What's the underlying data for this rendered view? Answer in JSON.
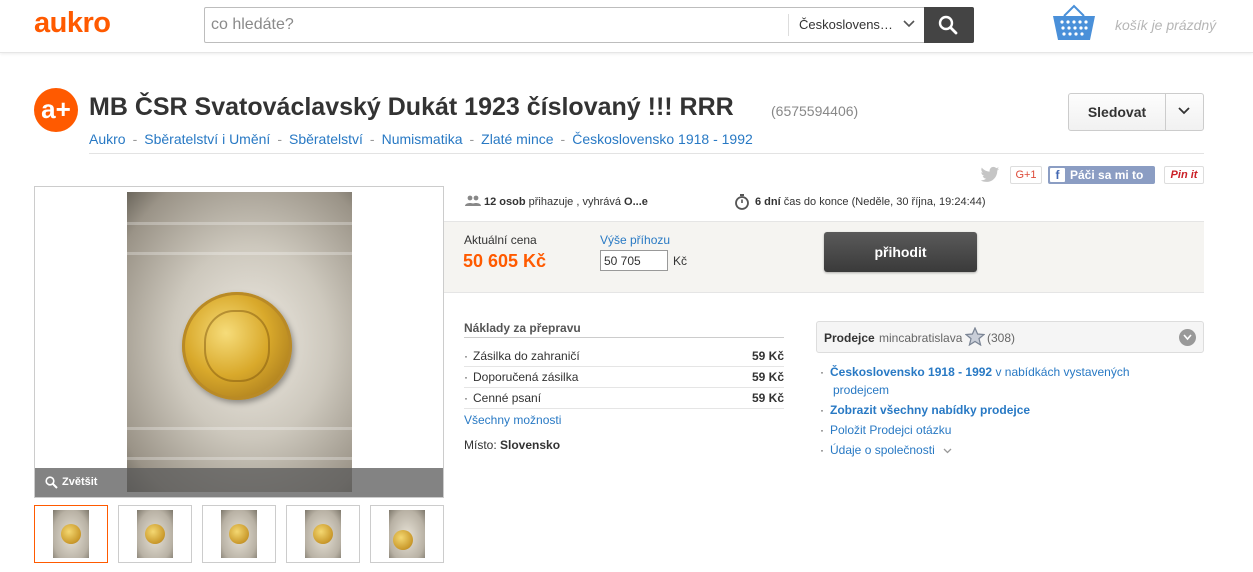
{
  "header": {
    "logo": "aukro",
    "search_placeholder": "co hledáte?",
    "search_category": "Českoslovens…",
    "cart_status": "košík je prázdný"
  },
  "item": {
    "logo_badge": "a+",
    "title": "MB ČSR Svatováclavský Dukát 1923 číslovaný !!! RRR",
    "id": "(6575594406)",
    "breadcrumb": [
      "Aukro",
      "Sběratelství i Umění",
      "Sběratelství",
      "Numismatika",
      "Zlaté mince",
      "Československo 1918 - 1992"
    ],
    "follow_label": "Sledovat"
  },
  "social": {
    "gplus": "G+1",
    "fb_like": "Páči sa mi to",
    "fb_f": "f",
    "pinit": "Pin it"
  },
  "gallery": {
    "zoom_label": "Zvětšit",
    "thumbnail_count": 5
  },
  "auction": {
    "bidders_count": "12 osob",
    "bidders_text": "přihazuje , vyhrává",
    "leader": "O...e",
    "time_left": "6 dní",
    "time_text": "čas do konce (Neděle, 30 října, 19:24:44)",
    "price_label": "Aktuální cena",
    "price": "50 605 Kč",
    "bid_label": "Výše příhozu",
    "bid_value": "50 705",
    "bid_currency": "Kč",
    "bid_button": "přihodit"
  },
  "shipping": {
    "heading": "Náklady za přepravu",
    "options": [
      {
        "name": "Zásilka do zahraničí",
        "price": "59 Kč"
      },
      {
        "name": "Doporučená zásilka",
        "price": "59 Kč"
      },
      {
        "name": "Cenné psaní",
        "price": "59 Kč"
      }
    ],
    "all_options": "Všechny možnosti",
    "place_label": "Místo:",
    "place_value": "Slovensko"
  },
  "seller": {
    "label": "Prodejce",
    "name": "mincabratislava",
    "rating": "(308)",
    "link1_bold": "Československo 1918 - 1992",
    "link1_rest": " v nabídkách vystavených",
    "link1_line2": "prodejcem",
    "link2": "Zobrazit všechny nabídky prodejce",
    "link3": "Položit Prodejci otázku",
    "link4": "Údaje o společnosti"
  },
  "colors": {
    "brand": "#ff5a00",
    "link": "#2879c4",
    "button_dark": "#444444"
  }
}
